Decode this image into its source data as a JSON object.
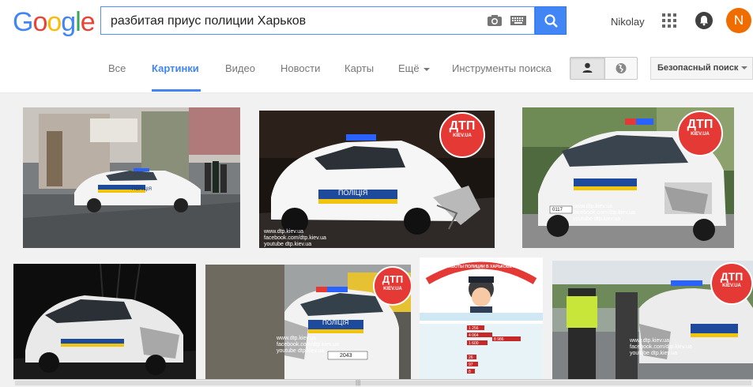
{
  "logo": {
    "letters": [
      "G",
      "o",
      "o",
      "g",
      "l",
      "e"
    ],
    "colors": [
      "#4285f4",
      "#ea4335",
      "#fbbc05",
      "#4285f4",
      "#34a853",
      "#ea4335"
    ]
  },
  "search": {
    "query": "разбитая приус полиции Харьков"
  },
  "header": {
    "user_name": "Nikolay",
    "avatar_letter": "N"
  },
  "tabs": {
    "all": "Все",
    "images": "Картинки",
    "video": "Видео",
    "news": "Новости",
    "maps": "Карты",
    "more": "Ещё",
    "tools": "Инструменты поиска"
  },
  "safe_search": {
    "label": "Безопасный поиск"
  },
  "results": {
    "badge_text": "ДТП",
    "badge_sub": "KIEV.UA",
    "watermark_1": "www.dtp.kiev.ua",
    "watermark_2": "facebook.com/dtp.kiev.ua",
    "watermark_3": "youtube dtp.kiev.ua",
    "car_label": "ПОЛІЦІЯ",
    "plate_1": "0117",
    "plate_2": "2043",
    "infographic_title": "ПОЛГОДА РАБОТЫ ПОЛИЦИИ В ХАРЬКОВЕ В ЦИФРАХ",
    "infographic_values": [
      "1 256",
      "4 064",
      "8 986",
      "1 600",
      "26",
      "97",
      "8"
    ]
  }
}
